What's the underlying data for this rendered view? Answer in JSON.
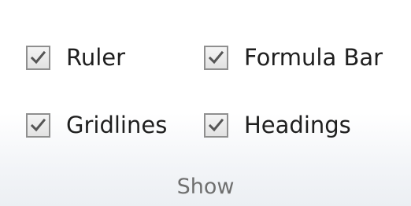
{
  "group": {
    "title": "Show",
    "options": [
      {
        "label": "Ruler",
        "checked": true
      },
      {
        "label": "Formula Bar",
        "checked": true
      },
      {
        "label": "Gridlines",
        "checked": true
      },
      {
        "label": "Headings",
        "checked": true
      }
    ]
  },
  "icons": {
    "check": "checkmark-icon"
  },
  "colors": {
    "label_text": "#1f1f1f",
    "title_text": "#6f6f6f",
    "checkbox_border": "#8f8f8f",
    "checkmark": "#555555"
  }
}
